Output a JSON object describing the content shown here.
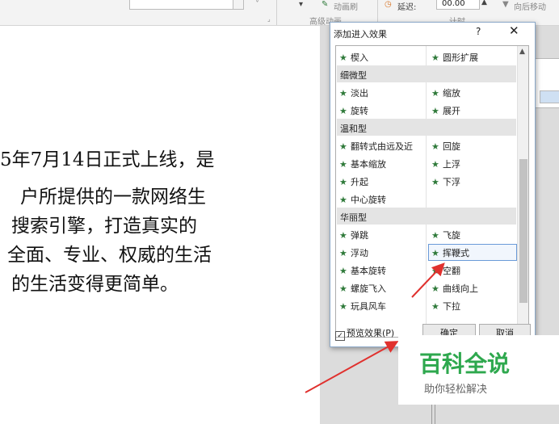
{
  "ribbon": {
    "animation_painter": "动画刷",
    "delay_label": "延迟:",
    "delay_value": "00.00",
    "move_later": "向后移动",
    "advanced_animation_group": "高级动画",
    "timing_group": "计时"
  },
  "document": {
    "lines": [
      "5年7月14日正式上线，是",
      "户所提供的一款网络生",
      "搜索引擎，打造真实的",
      "全面、专业、权威的生活",
      "的生活变得更简单。"
    ]
  },
  "dialog": {
    "title": "添加进入效果",
    "help": "?",
    "close": "✕",
    "rows": [
      {
        "type": "item",
        "left": "楔入",
        "right": "圆形扩展"
      },
      {
        "type": "cat",
        "label": "细微型"
      },
      {
        "type": "item",
        "left": "淡出",
        "right": "缩放"
      },
      {
        "type": "item",
        "left": "旋转",
        "right": "展开"
      },
      {
        "type": "cat",
        "label": "温和型"
      },
      {
        "type": "item",
        "left": "翻转式由远及近",
        "right": "回旋"
      },
      {
        "type": "item",
        "left": "基本缩放",
        "right": "上浮"
      },
      {
        "type": "item",
        "left": "升起",
        "right": "下浮"
      },
      {
        "type": "item",
        "left": "中心旋转",
        "right": ""
      },
      {
        "type": "cat",
        "label": "华丽型"
      },
      {
        "type": "item",
        "left": "弹跳",
        "right": "飞旋"
      },
      {
        "type": "item",
        "left": "浮动",
        "right": "挥鞭式"
      },
      {
        "type": "item",
        "left": "基本旋转",
        "right": "空翻"
      },
      {
        "type": "item",
        "left": "螺旋飞入",
        "right": "曲线向上"
      },
      {
        "type": "item",
        "left": "玩具风车",
        "right": "下拉"
      }
    ],
    "selected_effect": "挥鞭式",
    "preview_label": "预览效果(P)",
    "preview_checked": true,
    "ok": "确定",
    "cancel": "取消"
  },
  "watermark": {
    "main": "百科全说",
    "sub": "助你轻松解决"
  },
  "colors": {
    "arrow": "#e0312e",
    "watermark_green": "#2ea84e",
    "icon_green": "#2f7a3a"
  }
}
